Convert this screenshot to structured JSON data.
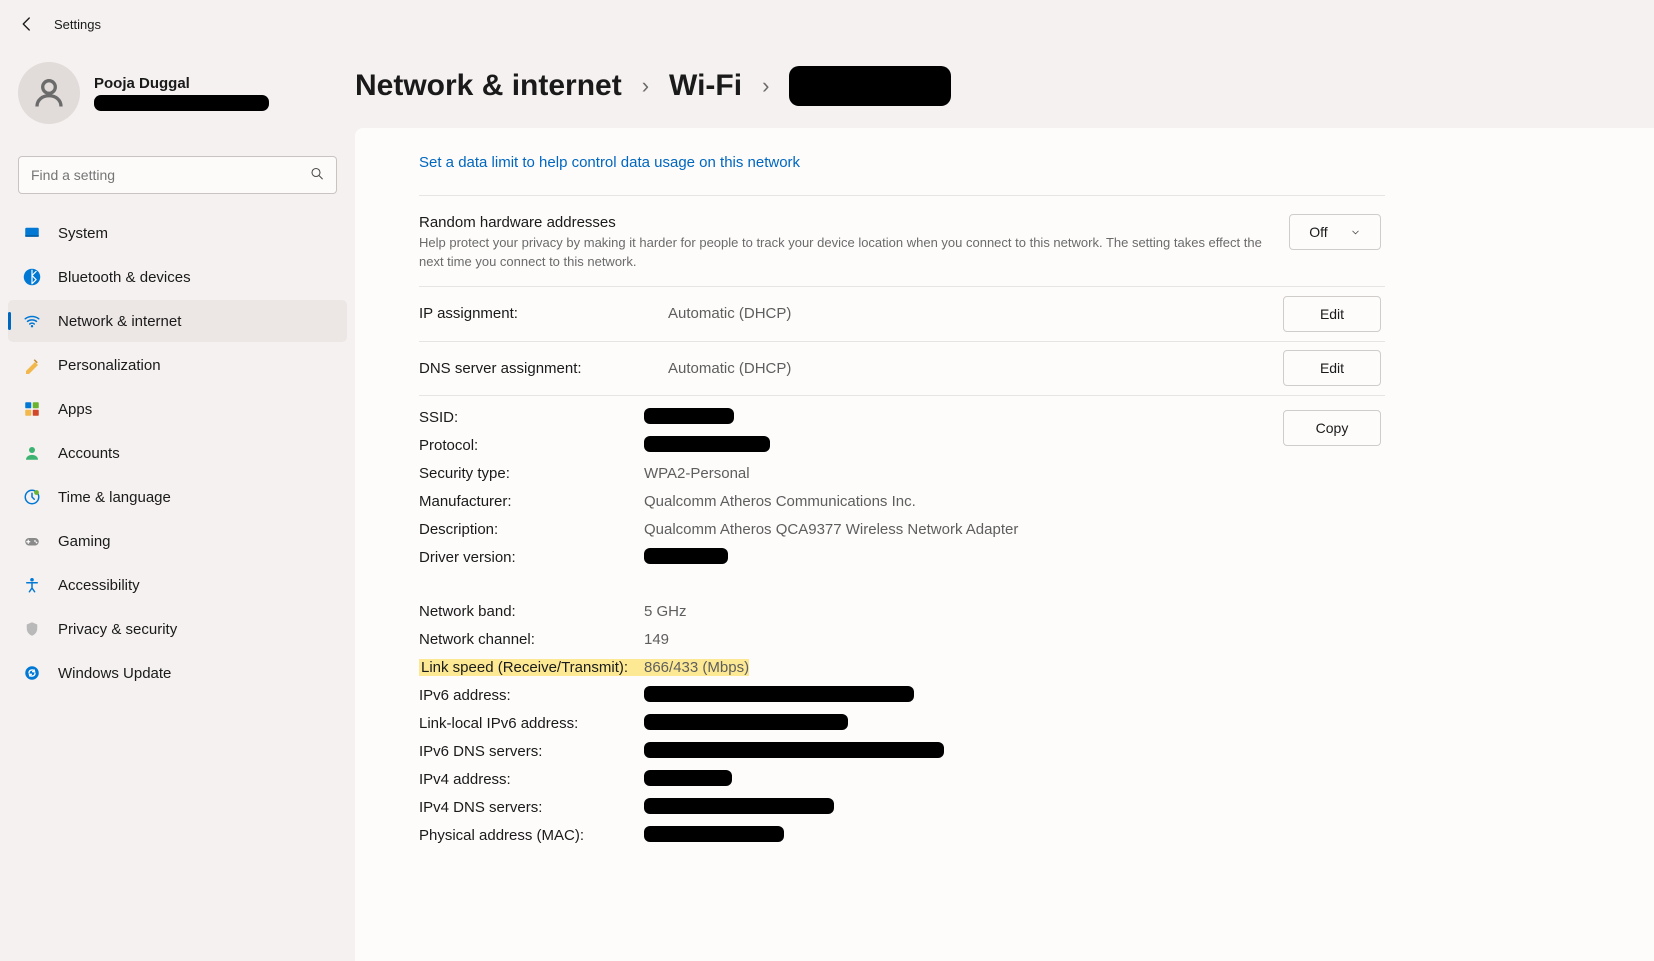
{
  "topbar": {
    "title": "Settings"
  },
  "user": {
    "name": "Pooja Duggal"
  },
  "search": {
    "placeholder": "Find a setting"
  },
  "sidebar": {
    "items": [
      {
        "label": "System",
        "icon": "sys",
        "active": false
      },
      {
        "label": "Bluetooth & devices",
        "icon": "bt",
        "active": false
      },
      {
        "label": "Network & internet",
        "icon": "wifi",
        "active": true
      },
      {
        "label": "Personalization",
        "icon": "pers",
        "active": false
      },
      {
        "label": "Apps",
        "icon": "apps",
        "active": false
      },
      {
        "label": "Accounts",
        "icon": "acct",
        "active": false
      },
      {
        "label": "Time & language",
        "icon": "time",
        "active": false
      },
      {
        "label": "Gaming",
        "icon": "game",
        "active": false
      },
      {
        "label": "Accessibility",
        "icon": "acc",
        "active": false
      },
      {
        "label": "Privacy & security",
        "icon": "priv",
        "active": false
      },
      {
        "label": "Windows Update",
        "icon": "upd",
        "active": false
      }
    ]
  },
  "breadcrumb": {
    "a": "Network & internet",
    "b": "Wi-Fi"
  },
  "link": {
    "data_limit": "Set a data limit to help control data usage on this network"
  },
  "hw": {
    "title": "Random hardware addresses",
    "sub": "Help protect your privacy by making it harder for people to track your device location when you connect to this network. The setting takes effect the next time you connect to this network.",
    "value": "Off"
  },
  "ip": {
    "label": "IP assignment:",
    "value": "Automatic (DHCP)",
    "btn": "Edit"
  },
  "dns": {
    "label": "DNS server assignment:",
    "value": "Automatic (DHCP)",
    "btn": "Edit"
  },
  "copy_btn": "Copy",
  "details": {
    "ssid_label": "SSID:",
    "protocol_label": "Protocol:",
    "security_label": "Security type:",
    "security_val": "WPA2-Personal",
    "manufacturer_label": "Manufacturer:",
    "manufacturer_val": "Qualcomm Atheros Communications Inc.",
    "description_label": "Description:",
    "description_val": "Qualcomm Atheros QCA9377 Wireless Network Adapter",
    "driver_label": "Driver version:",
    "band_label": "Network band:",
    "band_val": "5 GHz",
    "channel_label": "Network channel:",
    "channel_val": "149",
    "linkspeed_label": "Link speed (Receive/Transmit):",
    "linkspeed_val": "866/433 (Mbps)",
    "ipv6_label": "IPv6 address:",
    "linklocal_label": "Link-local IPv6 address:",
    "ipv6dns_label": "IPv6 DNS servers:",
    "ipv4_label": "IPv4 address:",
    "ipv4dns_label": "IPv4 DNS servers:",
    "mac_label": "Physical address (MAC):"
  }
}
